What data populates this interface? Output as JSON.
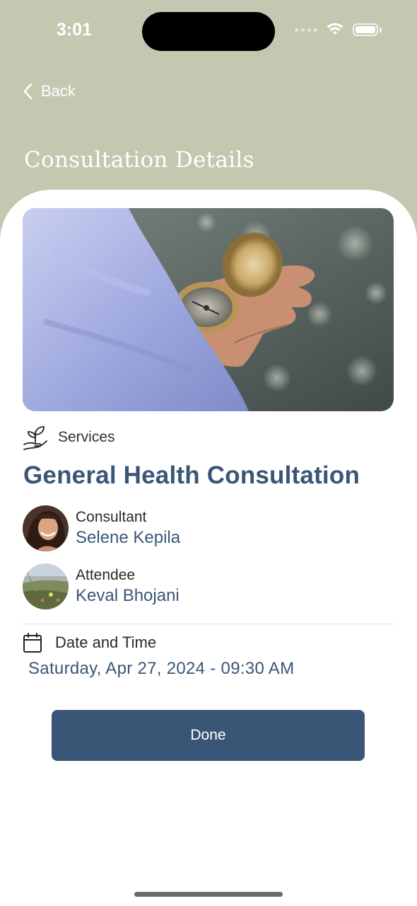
{
  "status_bar": {
    "time": "3:01"
  },
  "nav": {
    "back_label": "Back"
  },
  "page": {
    "title": "Consultation Details"
  },
  "service": {
    "category_label": "Services",
    "name": "General Health Consultation"
  },
  "consultant": {
    "role": "Consultant",
    "name": "Selene Kepila"
  },
  "attendee": {
    "role": "Attendee",
    "name": "Keval Bhojani"
  },
  "schedule": {
    "label": "Date and Time",
    "value": "Saturday, Apr 27, 2024 - 09:30 AM"
  },
  "actions": {
    "done_label": "Done"
  },
  "colors": {
    "header_bg": "#c4c8b0",
    "accent": "#3a5677"
  }
}
